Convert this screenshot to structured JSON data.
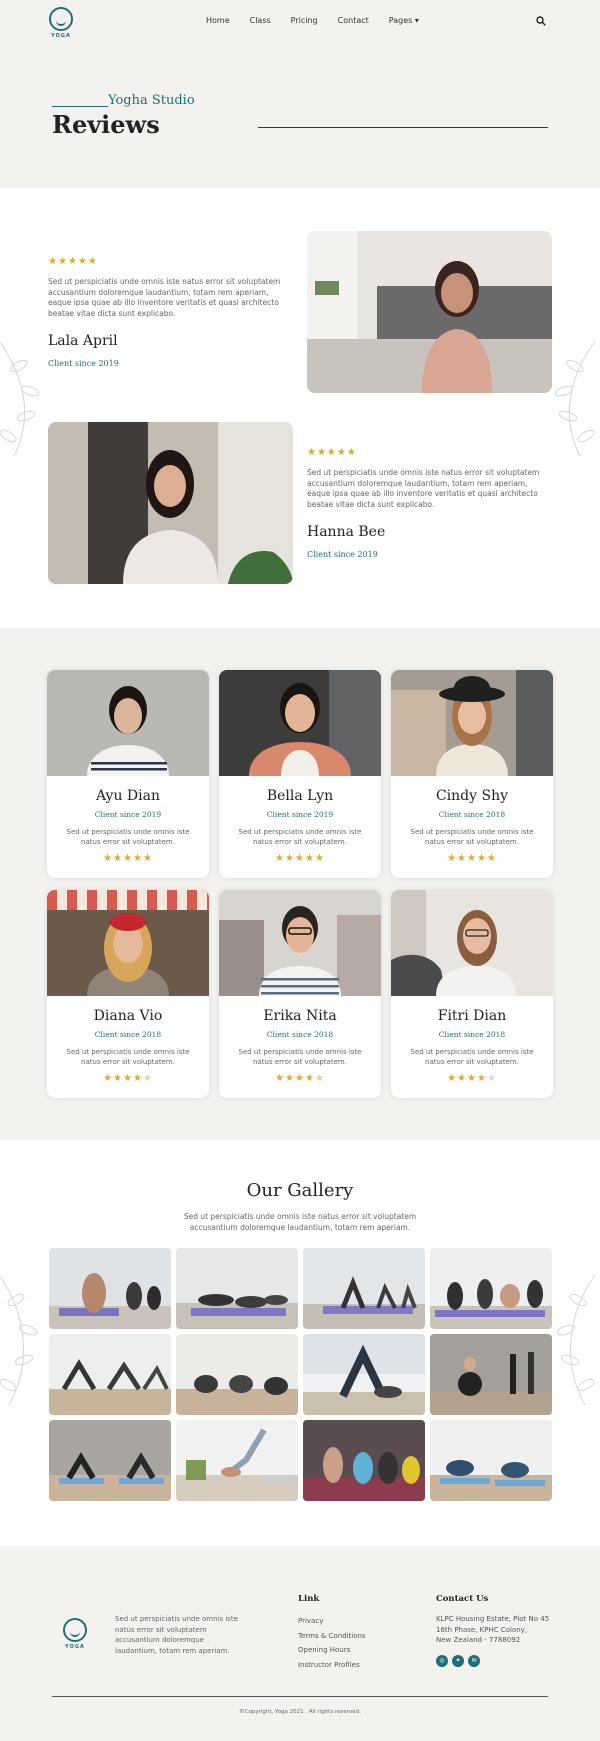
{
  "brand": {
    "logo_text": "YOGA",
    "footer_logo_text": "YOGA",
    "accent": "#1a6f7a",
    "star": "#e0a82e"
  },
  "nav": {
    "items": [
      "Home",
      "Class",
      "Pricing",
      "Contact",
      "Pages"
    ]
  },
  "hero": {
    "subtitle": "Yogha Studio",
    "title": "Reviews"
  },
  "featured": [
    {
      "stars": "★★★★★",
      "text": "Sed ut perspiciatis unde omnis iste natus error sit voluptatem accusantium doloremque laudantium, totam rem aperiam, eaque ipsa quae ab illo inventore veritatis et quasi architecto beatae vitae dicta sunt explicabo.",
      "name": "Lala April",
      "since": "Client since 2019"
    },
    {
      "stars": "★★★★★",
      "text": "Sed ut perspiciatis unde omnis iste natus error sit voluptatem accusantium doloremque laudantium, totam rem aperiam, eaque ipsa quae ab illo inventore veritatis et quasi architecto beatae vitae dicta sunt explicabo.",
      "name": "Hanna Bee",
      "since": "Client since 2019"
    }
  ],
  "clients": [
    {
      "name": "Ayu Dian",
      "since": "Client since 2019",
      "text": "Sed ut perspiciatis unde omnis iste natus error sit voluptatem.",
      "stars": "★★★★★",
      "rating": 5
    },
    {
      "name": "Bella Lyn",
      "since": "Client since 2019",
      "text": "Sed ut perspiciatis unde omnis iste natus error sit voluptatem.",
      "stars": "★★★★★",
      "rating": 5
    },
    {
      "name": "Cindy Shy",
      "since": "Client since 2018",
      "text": "Sed ut perspiciatis unde omnis iste natus error sit voluptatem.",
      "stars": "★★★★★",
      "rating": 5
    },
    {
      "name": "Diana Vio",
      "since": "Client since 2018",
      "text": "Sed ut perspiciatis unde omnis iste natus error sit voluptatem.",
      "stars": "★★★★",
      "rating": 4.5
    },
    {
      "name": "Erika Nita",
      "since": "Client since 2018",
      "text": "Sed ut perspiciatis unde omnis iste natus error sit voluptatem.",
      "stars": "★★★★",
      "rating": 4.5
    },
    {
      "name": "Fitri Dian",
      "since": "Client since 2018",
      "text": "Sed ut perspiciatis unde omnis iste natus error sit voluptatem.",
      "stars": "★★★★",
      "rating": 4
    }
  ],
  "gallery": {
    "title": "Our Gallery",
    "subtitle": "Sed ut perspiciatis unde omnis iste natus error sit voluptatem accusantium doloremque laudantium, totam rem aperiam."
  },
  "footer": {
    "about": "Sed ut perspiciatis unde omnis iste natus error sit voluptatem accusantium doloremque laudantium, totam rem aperiam.",
    "link_title": "Link",
    "links": [
      "Privacy",
      "Terms & Conditions",
      "Opening Hours",
      "Instructor Profiles"
    ],
    "contact_title": "Contact Us",
    "address": [
      "KLPC Housing Estate, Plot No 45",
      "16th Phase, KPHC Colony,",
      "New Zealand - 7788092"
    ],
    "copyright": "©Copyright, Yoga 2021 . All rights reserved."
  }
}
